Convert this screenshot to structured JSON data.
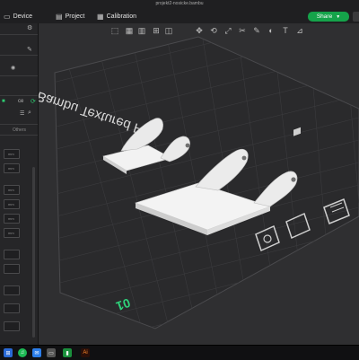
{
  "window": {
    "title": "projekt2-nosicke.bambu"
  },
  "menu": {
    "device_label": "Device",
    "project_label": "Project",
    "calibration_label": "Calibration"
  },
  "share": {
    "label": "Share"
  },
  "sidebar": {
    "plate_label": "ce",
    "tab_others": "Others",
    "unit_label": "mm"
  },
  "plate": {
    "name": "Bambu Textured PEI",
    "number": "01"
  },
  "colors": {
    "accent": "#15a34a",
    "plate_number": "#2fd27a",
    "bed": "#2e2e30",
    "grid": "#3a3a3d"
  },
  "icons": {
    "device": "monitor-icon",
    "project": "file-icon",
    "calibration": "calendar-icon"
  }
}
